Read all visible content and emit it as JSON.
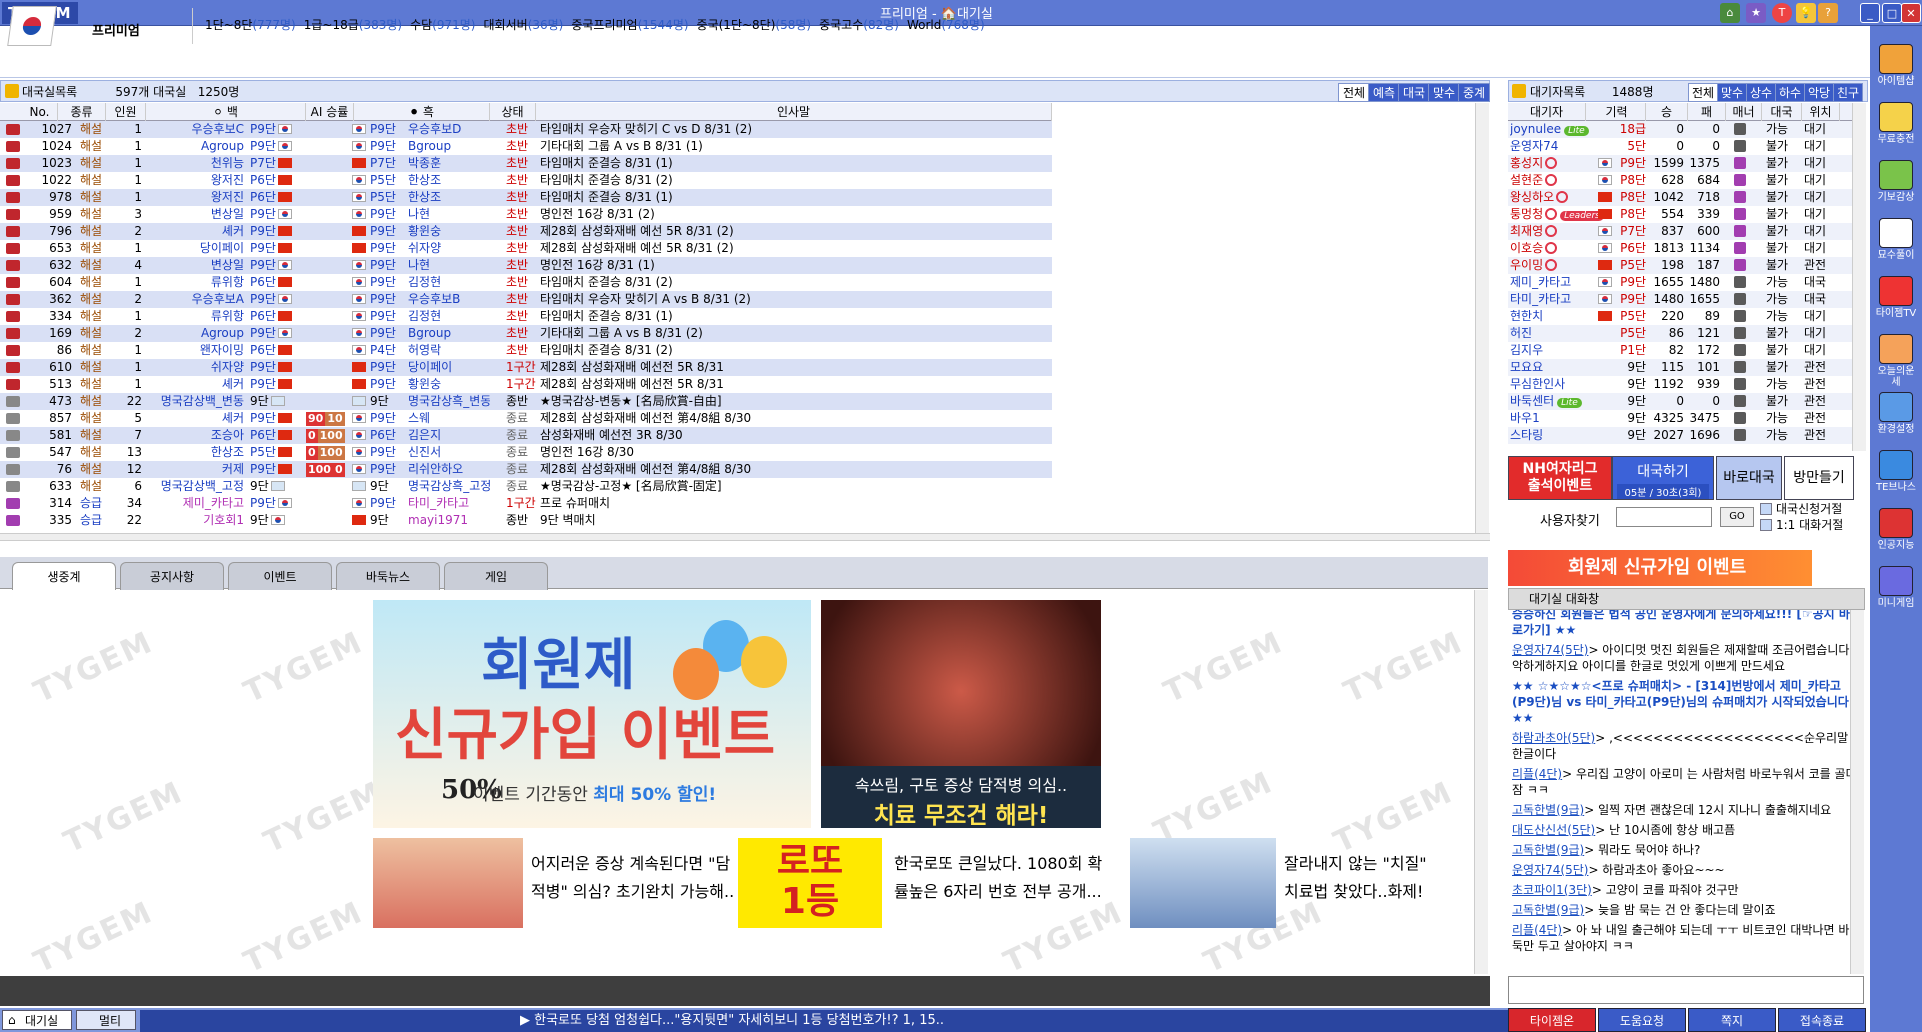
{
  "app": {
    "logo": "TYGEM",
    "title": "프리미엄 - 🏠대기실"
  },
  "header": {
    "grade": "프리미엄",
    "stats": [
      {
        "label": "1단~8단",
        "count": "(777명)"
      },
      {
        "label": "1급~18급",
        "count": "(383명)"
      },
      {
        "label": "수담",
        "count": "(971명)"
      },
      {
        "label": "대회서버",
        "count": "(36명)"
      },
      {
        "label": "중국프리미엄",
        "count": "(1544명)"
      },
      {
        "label": "중국(1단~8단)",
        "count": "(58명)"
      },
      {
        "label": "중국고수",
        "count": "(82명)"
      },
      {
        "label": "World",
        "count": "(768명)"
      }
    ]
  },
  "rooms": {
    "header_label": "대국실목록",
    "count_text": "597개 대국실",
    "people_text": "1250명",
    "tabs": [
      "전체",
      "예측",
      "대국",
      "맞수",
      "중계"
    ],
    "columns": [
      "No.",
      "종류",
      "인원",
      "⚪ 백",
      "AI 승률",
      "⚫ 흑",
      "상태",
      "인사말"
    ],
    "rows": [
      {
        "no": "1027",
        "kind": "해설",
        "people": "1",
        "white": "우승후보C",
        "wr": "P9단",
        "wf": "kr",
        "ai": "",
        "bf": "kr",
        "br": "P9단",
        "black": "우승후보D",
        "status": "초반",
        "msg": "타임매치 우승자 맞히기 C vs D 8/31 (2)",
        "icon": "r"
      },
      {
        "no": "1024",
        "kind": "해설",
        "people": "1",
        "white": "Agroup",
        "wr": "P9단",
        "wf": "kr",
        "ai": "",
        "bf": "kr",
        "br": "P9단",
        "black": "Bgroup",
        "status": "초반",
        "msg": "기타대회 그룹 A vs B 8/31 (1)",
        "icon": "r"
      },
      {
        "no": "1023",
        "kind": "해설",
        "people": "1",
        "white": "천위능",
        "wr": "P7단",
        "wf": "cn",
        "ai": "",
        "bf": "cn",
        "br": "P7단",
        "black": "박종훈",
        "status": "초반",
        "msg": "타임매치 준결승 8/31 (1)",
        "icon": "r"
      },
      {
        "no": "1022",
        "kind": "해설",
        "people": "1",
        "white": "왕저진",
        "wr": "P6단",
        "wf": "cn",
        "ai": "",
        "bf": "kr",
        "br": "P5단",
        "black": "한상조",
        "status": "초반",
        "msg": "타임매치 준결승 8/31 (2)",
        "icon": "r"
      },
      {
        "no": "978",
        "kind": "해설",
        "people": "1",
        "white": "왕저진",
        "wr": "P6단",
        "wf": "cn",
        "ai": "",
        "bf": "kr",
        "br": "P5단",
        "black": "한상조",
        "status": "초반",
        "msg": "타임매치 준결승 8/31 (1)",
        "icon": "r"
      },
      {
        "no": "959",
        "kind": "해설",
        "people": "3",
        "white": "변상일",
        "wr": "P9단",
        "wf": "kr",
        "ai": "",
        "bf": "kr",
        "br": "P9단",
        "black": "나현",
        "status": "초반",
        "msg": "명인전 16강 8/31 (2)",
        "icon": "r"
      },
      {
        "no": "796",
        "kind": "해설",
        "people": "2",
        "white": "셰커",
        "wr": "P9단",
        "wf": "cn",
        "ai": "",
        "bf": "cn",
        "br": "P9단",
        "black": "황윈숭",
        "status": "초반",
        "msg": "제28회 삼성화재배 예선 5R 8/31 (2)",
        "icon": "r"
      },
      {
        "no": "653",
        "kind": "해설",
        "people": "1",
        "white": "당이페이",
        "wr": "P9단",
        "wf": "cn",
        "ai": "",
        "bf": "cn",
        "br": "P9단",
        "black": "쉬자양",
        "status": "초반",
        "msg": "제28회 삼성화재배 예선 5R 8/31 (2)",
        "icon": "r"
      },
      {
        "no": "632",
        "kind": "해설",
        "people": "4",
        "white": "변상일",
        "wr": "P9단",
        "wf": "kr",
        "ai": "",
        "bf": "kr",
        "br": "P9단",
        "black": "나현",
        "status": "초반",
        "msg": "명인전 16강 8/31 (1)",
        "icon": "r"
      },
      {
        "no": "604",
        "kind": "해설",
        "people": "1",
        "white": "류위항",
        "wr": "P6단",
        "wf": "cn",
        "ai": "",
        "bf": "kr",
        "br": "P9단",
        "black": "김정현",
        "status": "초반",
        "msg": "타임매치 준결승 8/31 (2)",
        "icon": "r"
      },
      {
        "no": "362",
        "kind": "해설",
        "people": "2",
        "white": "우승후보A",
        "wr": "P9단",
        "wf": "kr",
        "ai": "",
        "bf": "kr",
        "br": "P9단",
        "black": "우승후보B",
        "status": "초반",
        "msg": "타임매치 우승자 맞히기 A vs B 8/31 (2)",
        "icon": "r"
      },
      {
        "no": "334",
        "kind": "해설",
        "people": "1",
        "white": "류위항",
        "wr": "P6단",
        "wf": "cn",
        "ai": "",
        "bf": "kr",
        "br": "P9단",
        "black": "김정현",
        "status": "초반",
        "msg": "타임매치 준결승 8/31 (1)",
        "icon": "r"
      },
      {
        "no": "169",
        "kind": "해설",
        "people": "2",
        "white": "Agroup",
        "wr": "P9단",
        "wf": "kr",
        "ai": "",
        "bf": "kr",
        "br": "P9단",
        "black": "Bgroup",
        "status": "초반",
        "msg": "기타대회 그룹 A vs B 8/31 (2)",
        "icon": "r"
      },
      {
        "no": "86",
        "kind": "해설",
        "people": "1",
        "white": "왠자이밍",
        "wr": "P6단",
        "wf": "cn",
        "ai": "",
        "bf": "kr",
        "br": "P4단",
        "black": "허영락",
        "status": "초반",
        "msg": "타임매치 준결승 8/31 (2)",
        "icon": "r"
      },
      {
        "no": "610",
        "kind": "해설",
        "people": "1",
        "white": "쉬자양",
        "wr": "P9단",
        "wf": "cn",
        "ai": "",
        "bf": "cn",
        "br": "P9단",
        "black": "당이페이",
        "status": "1구간",
        "msg": "제28회 삼성화재배 예선전 5R 8/31",
        "icon": "r"
      },
      {
        "no": "513",
        "kind": "해설",
        "people": "1",
        "white": "셰커",
        "wr": "P9단",
        "wf": "cn",
        "ai": "",
        "bf": "cn",
        "br": "P9단",
        "black": "황윈숭",
        "status": "1구간",
        "msg": "제28회 삼성화재배 예선전 5R 8/31",
        "icon": "r"
      },
      {
        "no": "473",
        "kind": "해설",
        "people": "22",
        "white": "명국감상백_변동",
        "wr": "9단",
        "wf": "tw",
        "ai": "",
        "bf": "tw",
        "br": "9단",
        "black": "명국감상흑_변동",
        "status": "종반",
        "msg": "★명국감상-변동★ [名局欣賞-自由]",
        "icon": "g"
      },
      {
        "no": "857",
        "kind": "해설",
        "people": "5",
        "white": "셰커",
        "wr": "P9단",
        "wf": "cn",
        "ai": "90 10",
        "bf": "kr",
        "br": "P9단",
        "black": "스웨",
        "status": "종료",
        "msg": "제28회 삼성화재배 예선전 第4/8組 8/30",
        "icon": "g"
      },
      {
        "no": "581",
        "kind": "해설",
        "people": "7",
        "white": "조승아",
        "wr": "P6단",
        "wf": "cn",
        "ai": "0 100",
        "bf": "kr",
        "br": "P6단",
        "black": "김은지",
        "status": "종료",
        "msg": "삼성화재배 예선전 3R 8/30",
        "icon": "g"
      },
      {
        "no": "547",
        "kind": "해설",
        "people": "13",
        "white": "한상조",
        "wr": "P5단",
        "wf": "cn",
        "ai": "0 100",
        "bf": "kr",
        "br": "P9단",
        "black": "신진서",
        "status": "종료",
        "msg": "명인전 16강 8/30",
        "icon": "g"
      },
      {
        "no": "76",
        "kind": "해설",
        "people": "12",
        "white": "커제",
        "wr": "P9단",
        "wf": "cn",
        "ai": "100 0",
        "bf": "kr",
        "br": "P9단",
        "black": "리쉬안하오",
        "status": "종료",
        "msg": "제28회 삼성화재배 예선전 第4/8組 8/30",
        "icon": "g"
      },
      {
        "no": "633",
        "kind": "해설",
        "people": "6",
        "white": "명국감상백_고정",
        "wr": "9단",
        "wf": "tw",
        "ai": "",
        "bf": "tw",
        "br": "9단",
        "black": "명국감상흑_고정",
        "status": "종료",
        "msg": "★명국감상-고정★ [名局欣賞-固定]",
        "icon": "g"
      },
      {
        "no": "314",
        "kind": "승급",
        "people": "34",
        "white": "제미_카타고",
        "wr": "P9단",
        "wf": "kr",
        "ai": "",
        "bf": "kr",
        "br": "P9단",
        "black": "타미_카타고",
        "status": "1구간",
        "msg": "프로 슈퍼매치",
        "icon": "p"
      },
      {
        "no": "335",
        "kind": "승급",
        "people": "22",
        "white": "기호회1",
        "wr": "9단",
        "wf": "kr",
        "ai": "",
        "bf": "cn",
        "br": "9단",
        "black": "mayi1971",
        "status": "종반",
        "msg": "9단 벽매치",
        "icon": "p"
      }
    ]
  },
  "news": {
    "tabs": [
      "생중계",
      "공지사항",
      "이벤트",
      "바둑뉴스",
      "게임"
    ],
    "watermark": "TYGEM",
    "banner_a": {
      "title1": "회원제",
      "title2": "신규가입 이벤트",
      "badge": "50%",
      "desc_prefix": "이벤트 기간동안 ",
      "desc_em": "최대 50% 할인!"
    },
    "banner_b": {
      "line1": "속쓰림, 구토 증상 담적병 의심..",
      "line2": "치료 무조건 해라!"
    },
    "ads": [
      {
        "text1": "어지러운 증상 계속된다면 \"담",
        "text2": "적병\" 의심? 초기완치 가능해.."
      },
      {
        "text1": "한국로또 큰일났다. 1080회 확",
        "text2": "률높은 6자리 번호 전부 공개..."
      },
      {
        "text1": "잘라내지 않는 \"치질\"",
        "text2": "치료법 찾았다..화제!"
      }
    ],
    "lotto": {
      "line1": "로또",
      "line2": "1등"
    }
  },
  "bottom": {
    "tab_lobby": "대기실",
    "tab_multi": "멀티",
    "ticker": "▶ 한국로또 당첨 엄청쉽다...\"용지뒷면\" 자세히보니 1등 당첨번호가!? 1, 15.."
  },
  "waiting": {
    "header_label": "대기자목록",
    "count": "1488명",
    "tabs": [
      "전체",
      "맞수",
      "상수",
      "하수",
      "악당",
      "친구"
    ],
    "columns": [
      "대기자",
      "기력",
      "승",
      "패",
      "매너",
      "대국",
      "위치"
    ],
    "rows": [
      {
        "name": "joynulee",
        "badge": "Lite",
        "flag": "",
        "rank": "18급",
        "w": "0",
        "l": "0",
        "play": "가능",
        "loc": "대기",
        "icon": false
      },
      {
        "name": "운영자74",
        "badge": "",
        "flag": "",
        "rank": "5단",
        "w": "0",
        "l": "0",
        "play": "불가",
        "loc": "대기",
        "icon": false
      },
      {
        "name": "홍성지",
        "badge": "",
        "flag": "kr",
        "rank": "P9단",
        "w": "1599",
        "l": "1375",
        "play": "불가",
        "loc": "대기",
        "icon": true
      },
      {
        "name": "설현준",
        "badge": "",
        "flag": "kr",
        "rank": "P8단",
        "w": "628",
        "l": "684",
        "play": "불가",
        "loc": "대기",
        "icon": true
      },
      {
        "name": "왕싱하오",
        "badge": "",
        "flag": "cn",
        "rank": "P8단",
        "w": "1042",
        "l": "718",
        "play": "불가",
        "loc": "대기",
        "icon": true
      },
      {
        "name": "퉁멍청",
        "badge": "Leaders",
        "flag": "cn",
        "rank": "P8단",
        "w": "554",
        "l": "339",
        "play": "불가",
        "loc": "대기",
        "icon": true
      },
      {
        "name": "최재영",
        "badge": "",
        "flag": "kr",
        "rank": "P7단",
        "w": "837",
        "l": "600",
        "play": "불가",
        "loc": "대기",
        "icon": true
      },
      {
        "name": "이호승",
        "badge": "",
        "flag": "kr",
        "rank": "P6단",
        "w": "1813",
        "l": "1134",
        "play": "불가",
        "loc": "대기",
        "icon": true
      },
      {
        "name": "우이밍",
        "badge": "",
        "flag": "cn",
        "rank": "P5단",
        "w": "198",
        "l": "187",
        "play": "불가",
        "loc": "관전",
        "icon": true
      },
      {
        "name": "제미_카타고",
        "badge": "",
        "flag": "kr",
        "rank": "P9단",
        "w": "1655",
        "l": "1480",
        "play": "가능",
        "loc": "대국",
        "icon": false
      },
      {
        "name": "타미_카타고",
        "badge": "",
        "flag": "kr",
        "rank": "P9단",
        "w": "1480",
        "l": "1655",
        "play": "가능",
        "loc": "대국",
        "icon": false
      },
      {
        "name": "현한치",
        "badge": "",
        "flag": "cn",
        "rank": "P5단",
        "w": "220",
        "l": "89",
        "play": "가능",
        "loc": "대기",
        "icon": false
      },
      {
        "name": "허진",
        "badge": "",
        "flag": "",
        "rank": "P5단",
        "w": "86",
        "l": "121",
        "play": "불가",
        "loc": "대기",
        "icon": false
      },
      {
        "name": "김지우",
        "badge": "",
        "flag": "",
        "rank": "P1단",
        "w": "82",
        "l": "172",
        "play": "불가",
        "loc": "대기",
        "icon": false
      },
      {
        "name": "모요요",
        "badge": "",
        "flag": "",
        "rank": "9단",
        "w": "115",
        "l": "101",
        "play": "불가",
        "loc": "관전",
        "icon": false
      },
      {
        "name": "무심한인사",
        "badge": "",
        "flag": "",
        "rank": "9단",
        "w": "1192",
        "l": "939",
        "play": "가능",
        "loc": "관전",
        "icon": false
      },
      {
        "name": "바둑센터",
        "badge": "Lite",
        "flag": "",
        "rank": "9단",
        "w": "0",
        "l": "0",
        "play": "불가",
        "loc": "관전",
        "icon": false
      },
      {
        "name": "바우1",
        "badge": "",
        "flag": "",
        "rank": "9단",
        "w": "4325",
        "l": "3475",
        "play": "가능",
        "loc": "관전",
        "icon": false
      },
      {
        "name": "스타링",
        "badge": "",
        "flag": "",
        "rank": "9단",
        "w": "2027",
        "l": "1696",
        "play": "가능",
        "loc": "관전",
        "icon": false
      }
    ]
  },
  "actions": {
    "nh": [
      "NH여자리그",
      "출석이벤트"
    ],
    "start_game": "대국하기",
    "start_sub": "05분 / 30초(3회)",
    "quick": "바로대국",
    "create_room": "방만들기",
    "find_user": "사용자찾기",
    "go": "GO",
    "refuse_game": "대국신청거절",
    "refuse_chat": "1:1 대화거절"
  },
  "event_banner": "회원제 신규가입 이벤트",
  "chat": {
    "title": "대기실 대화창",
    "lines": [
      {
        "sys": true,
        "text": "승승하신 회원들은 법적 공인 운영자에게 문의하세요!!! [☞공지 바로가기] ★★"
      },
      {
        "name": "운영자74(5단)",
        "text": "> 아이디멋 멋진 회원들은 제재할때 조금어렵습니다 악하게하지요 아이디를 한글로 멋있게 이쁘게 만드세요"
      },
      {
        "sys": true,
        "text": "★★ ☆★☆★☆<프로 슈퍼매치> - [314]번방에서 제미_카타고(P9단)님 vs 타미_카타고(P9단)님의 슈퍼매치가 시작되었습니다. ★★"
      },
      {
        "name": "하람과초아(5단)",
        "text": "> ,<<<<<<<<<<<<<<<<<<<순우리말 한글이다"
      },
      {
        "name": "리플(4단)",
        "text": "> 우리집  고양이 아로미 는 사람처럼 바로누워서 코를 골며잠  ㅋㅋ"
      },
      {
        "name": "고독한별(9급)",
        "text": "> 일찍 자면 괜찮은데 12시 지나니 출출해지네요"
      },
      {
        "name": "대도산신선(5단)",
        "text": "> 난 10시좀에 항상 배고픔"
      },
      {
        "name": "고독한별(9급)",
        "text": "> 뭐라도 묵어야 하나?"
      },
      {
        "name": "운영자74(5단)",
        "text": "> 하람과초아 좋아요~~~"
      },
      {
        "name": "초코파이1(3단)",
        "text": "> 고양이 코를 파줘야 것구만"
      },
      {
        "name": "고독한별(9급)",
        "text": "> 늦을 밤 묵는 건 안 좋다는데 말이죠"
      },
      {
        "name": "리플(4단)",
        "text": "> 아  놔  내일 출근해야 되는데     ㅜㅜ  비트코인 대박나면   바둑만 두고  살아야지  ㅋㅋ"
      }
    ]
  },
  "bottom_buttons": [
    "타이젬온",
    "도움요청",
    "쪽지",
    "접속종료"
  ],
  "sidebar": [
    "아이템샵",
    "무료충전",
    "기보감상",
    "묘수풀이",
    "타이젬TV",
    "오늘의운세",
    "환경설정",
    "TE브나스",
    "인공지능",
    "미니게임"
  ],
  "colors": {
    "titlebar": "#5d79d3",
    "row_alt": "#d9e0f5",
    "accent_red": "#e22b2b",
    "accent_blue": "#3a5bc7"
  }
}
